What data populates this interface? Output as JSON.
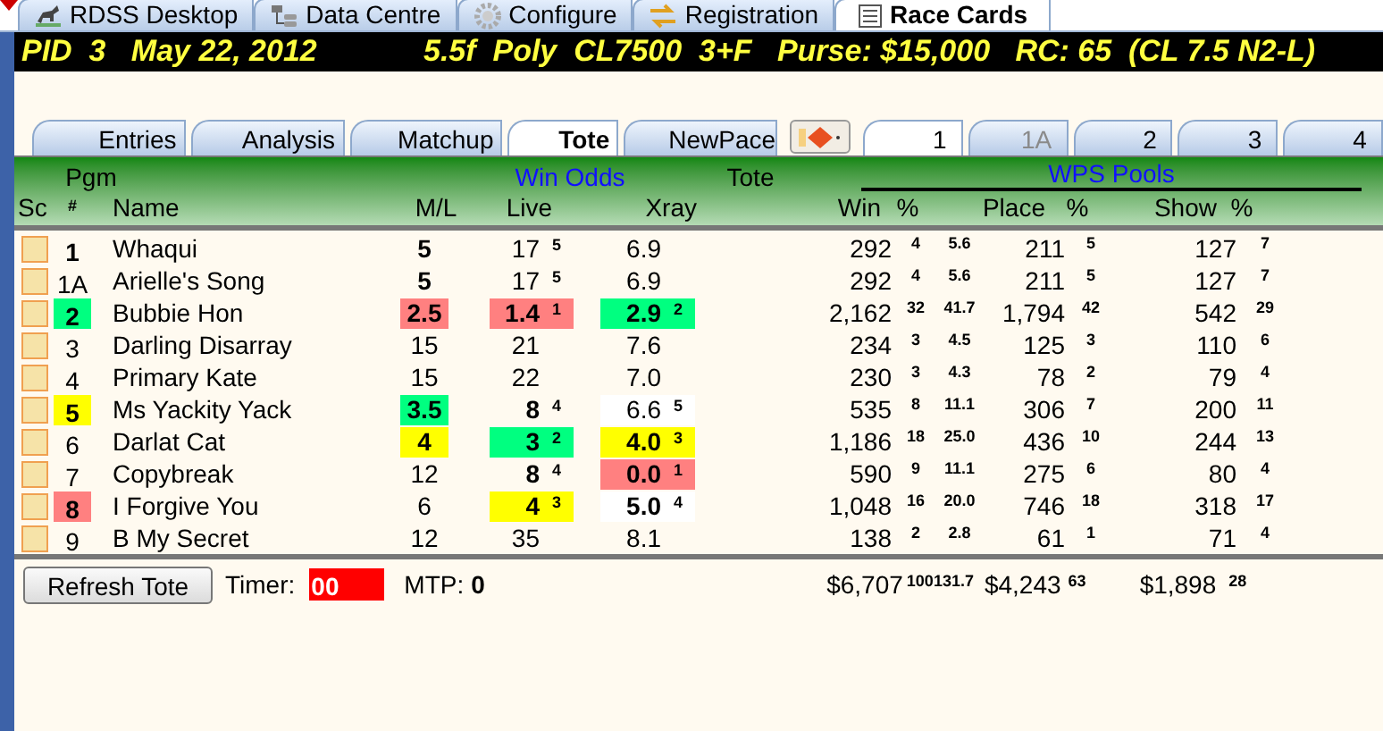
{
  "window_tabs": [
    {
      "label": "RDSS Desktop",
      "selected": false
    },
    {
      "label": "Data Centre",
      "selected": false
    },
    {
      "label": "Configure",
      "selected": false
    },
    {
      "label": "Registration",
      "selected": false
    },
    {
      "label": "Race Cards",
      "selected": true
    }
  ],
  "race_header": {
    "left": "PID  3   May 22, 2012",
    "right": "5.5f  Poly  CL7500  3+F   Purse: $15,000   RC: 65  (CL 7.5 N2-L)"
  },
  "view_tabs": [
    {
      "kind": "text",
      "label": "Entries",
      "selected": false
    },
    {
      "kind": "text",
      "label": "Analysis",
      "selected": false
    },
    {
      "kind": "text",
      "label": "Matchup",
      "selected": false
    },
    {
      "kind": "text",
      "label": "Tote",
      "selected": true
    },
    {
      "kind": "text",
      "label": "NewPace",
      "selected": false
    },
    {
      "kind": "icon",
      "selected": false
    }
  ],
  "horse_tabs": [
    {
      "label": "1",
      "selected": true,
      "disabled": false
    },
    {
      "label": "1A",
      "selected": false,
      "disabled": true
    },
    {
      "label": "2",
      "selected": false,
      "disabled": false
    },
    {
      "label": "3",
      "selected": false,
      "disabled": false
    },
    {
      "label": "4",
      "selected": false,
      "disabled": false
    }
  ],
  "headers": {
    "sc": "Sc",
    "pgm": "Pgm",
    "pgm_num": "#",
    "name": "Name",
    "win_odds": "Win Odds",
    "ml": "M/L",
    "live": "Live",
    "tote": "Tote",
    "xray": "Xray",
    "wps_pools": "WPS Pools",
    "win": "Win",
    "win_pct": "%",
    "place": "Place",
    "place_pct": "%",
    "show": "Show",
    "show_pct": "%"
  },
  "rows": [
    {
      "checked": false,
      "pgm": {
        "text": "1",
        "bold": true
      },
      "name": "Whaqui",
      "ml": {
        "text": "5",
        "bold": true
      },
      "live": {
        "text": "17",
        "rank": "5",
        "bold": false
      },
      "xray": {
        "text": "6.9",
        "bold": false
      },
      "win": "292",
      "win_pct": "4",
      "win_share": "5.6",
      "place": "211",
      "place_pct": "5",
      "show": "127",
      "show_pct": "7"
    },
    {
      "checked": false,
      "pgm": {
        "text": "1A",
        "bold": false
      },
      "name": "Arielle's Song",
      "ml": {
        "text": "5",
        "bold": true
      },
      "live": {
        "text": "17",
        "rank": "5",
        "bold": false
      },
      "xray": {
        "text": "6.9",
        "bold": false
      },
      "win": "292",
      "win_pct": "4",
      "win_share": "5.6",
      "place": "211",
      "place_pct": "5",
      "show": "127",
      "show_pct": "7"
    },
    {
      "checked": false,
      "pgm": {
        "text": "2",
        "bold": true,
        "color": "#00ff80"
      },
      "name": "Bubbie Hon",
      "ml": {
        "text": "2.5",
        "bold": true,
        "color": "#ff8080"
      },
      "live": {
        "text": "1.4",
        "rank": "1",
        "bold": true,
        "color": "#ff8080"
      },
      "xray": {
        "text": "2.9",
        "rank": "2",
        "bold": true,
        "color": "#00ff80"
      },
      "win": "2,162",
      "win_pct": "32",
      "win_share": "41.7",
      "place": "1,794",
      "place_pct": "42",
      "show": "542",
      "show_pct": "29"
    },
    {
      "checked": false,
      "pgm": {
        "text": "3",
        "bold": false
      },
      "name": "Darling Disarray",
      "ml": {
        "text": "15",
        "bold": false
      },
      "live": {
        "text": "21",
        "bold": false
      },
      "xray": {
        "text": "7.6",
        "bold": false
      },
      "win": "234",
      "win_pct": "3",
      "win_share": "4.5",
      "place": "125",
      "place_pct": "3",
      "show": "110",
      "show_pct": "6"
    },
    {
      "checked": false,
      "pgm": {
        "text": "4",
        "bold": false
      },
      "name": "Primary Kate",
      "ml": {
        "text": "15",
        "bold": false
      },
      "live": {
        "text": "22",
        "bold": false
      },
      "xray": {
        "text": "7.0",
        "bold": false
      },
      "win": "230",
      "win_pct": "3",
      "win_share": "4.3",
      "place": "78",
      "place_pct": "2",
      "show": "79",
      "show_pct": "4"
    },
    {
      "checked": false,
      "pgm": {
        "text": "5",
        "bold": true,
        "color": "#ffff00"
      },
      "name": "Ms Yackity Yack",
      "ml": {
        "text": "3.5",
        "bold": true,
        "color": "#00ff80"
      },
      "live": {
        "text": "8",
        "rank": "4",
        "bold": true
      },
      "xray": {
        "text": "6.6",
        "rank": "5",
        "bold": false,
        "color": "#ffffff"
      },
      "win": "535",
      "win_pct": "8",
      "win_share": "11.1",
      "place": "306",
      "place_pct": "7",
      "show": "200",
      "show_pct": "11"
    },
    {
      "checked": false,
      "pgm": {
        "text": "6",
        "bold": false
      },
      "name": "Darlat Cat",
      "ml": {
        "text": "4",
        "bold": true,
        "color": "#ffff00"
      },
      "live": {
        "text": "3",
        "rank": "2",
        "bold": true,
        "color": "#00ff80"
      },
      "xray": {
        "text": "4.0",
        "rank": "3",
        "bold": true,
        "color": "#ffff00"
      },
      "win": "1,186",
      "win_pct": "18",
      "win_share": "25.0",
      "place": "436",
      "place_pct": "10",
      "show": "244",
      "show_pct": "13"
    },
    {
      "checked": false,
      "pgm": {
        "text": "7",
        "bold": false
      },
      "name": "Copybreak",
      "ml": {
        "text": "12",
        "bold": false
      },
      "live": {
        "text": "8",
        "rank": "4",
        "bold": true
      },
      "xray": {
        "text": "0.0",
        "rank": "1",
        "bold": true,
        "color": "#ff8080"
      },
      "win": "590",
      "win_pct": "9",
      "win_share": "11.1",
      "place": "275",
      "place_pct": "6",
      "show": "80",
      "show_pct": "4"
    },
    {
      "checked": false,
      "pgm": {
        "text": "8",
        "bold": true,
        "color": "#ff8080"
      },
      "name": "I Forgive You",
      "ml": {
        "text": "6",
        "bold": false
      },
      "live": {
        "text": "4",
        "rank": "3",
        "bold": true,
        "color": "#ffff00"
      },
      "xray": {
        "text": "5.0",
        "rank": "4",
        "bold": true,
        "color": "#ffffff"
      },
      "win": "1,048",
      "win_pct": "16",
      "win_share": "20.0",
      "place": "746",
      "place_pct": "18",
      "show": "318",
      "show_pct": "17"
    },
    {
      "checked": false,
      "pgm": {
        "text": "9",
        "bold": false
      },
      "name": "B My Secret",
      "ml": {
        "text": "12",
        "bold": false
      },
      "live": {
        "text": "35",
        "bold": false
      },
      "xray": {
        "text": "8.1",
        "bold": false
      },
      "win": "138",
      "win_pct": "2",
      "win_share": "2.8",
      "place": "61",
      "place_pct": "1",
      "show": "71",
      "show_pct": "4"
    }
  ],
  "footer": {
    "refresh_button": "Refresh Tote",
    "timer_label": "Timer:",
    "timer_value": "00",
    "mtp_label": "MTP:",
    "mtp_value": "0",
    "win_total": "$6,707",
    "win_pct": "100",
    "win_share": "131.7",
    "place_total": "$4,243",
    "place_pct": "63",
    "show_total": "$1,898",
    "show_pct": "28"
  }
}
